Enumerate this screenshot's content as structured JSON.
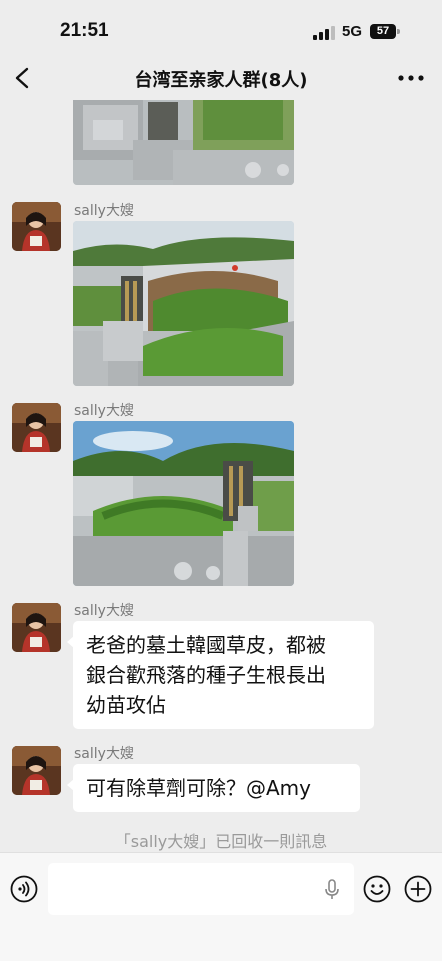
{
  "status_bar": {
    "time": "21:51",
    "network": "5G",
    "battery": "57"
  },
  "nav": {
    "title": "台湾至亲家人群(8人)",
    "back_icon": "chevron-left-icon",
    "more_icon": "more-dots-icon"
  },
  "messages": [
    {
      "type": "image",
      "sender": "",
      "image_subject": "grave-photo"
    },
    {
      "type": "image",
      "sender": "sally大嫂",
      "image_subject": "grave-photo"
    },
    {
      "type": "image",
      "sender": "sally大嫂",
      "image_subject": "grave-photo"
    },
    {
      "type": "text",
      "sender": "sally大嫂",
      "lines": [
        "老爸的墓土韓國草皮，都被",
        "銀合歡飛落的種子生根長出",
        "幼苗攻佔"
      ]
    },
    {
      "type": "text",
      "sender": "sally大嫂",
      "lines": [
        "可有除草劑可除？@Amy"
      ]
    }
  ],
  "recall_notice": "「sally大嫂」已回收一則訊息",
  "input_bar": {
    "voice_icon": "voice-icon",
    "mic_icon": "microphone-icon",
    "emoji_icon": "emoji-icon",
    "plus_icon": "plus-circle-icon",
    "value": ""
  },
  "colors": {
    "background": "#ededed",
    "bubble": "#ffffff",
    "sender_name": "#7a7a7a",
    "notice": "#9a9a9a"
  }
}
